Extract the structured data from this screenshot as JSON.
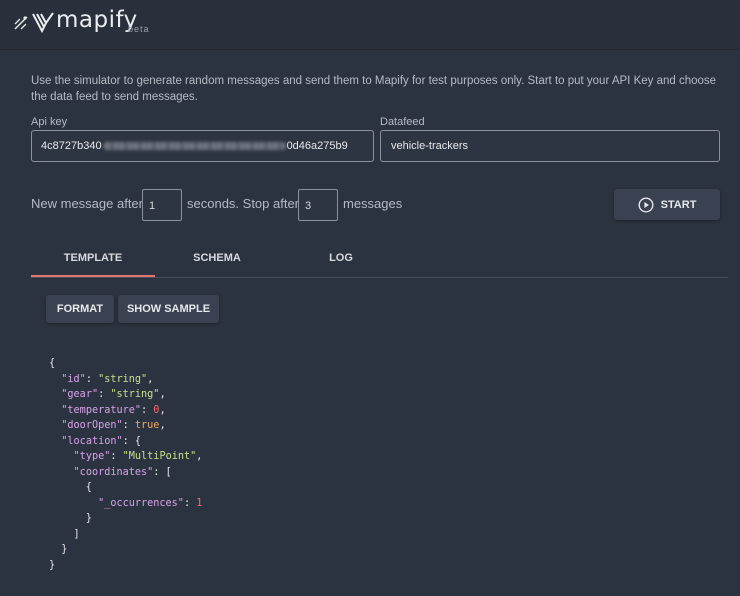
{
  "header": {
    "brand": "mapify",
    "badge": "beta",
    "icons": [
      "tool-icon",
      "mapify-logo-icon"
    ]
  },
  "intro": "Use the simulator to generate random messages and send them to Mapify for test purposes only. Start to put your API Key and choose the data feed to send messages.",
  "form": {
    "api_key_label": "Api key",
    "api_key_prefix": "4c8727b340",
    "api_key_suffix": "0d46a275b9",
    "datafeed_label": "Datafeed",
    "datafeed_value": "vehicle-trackers"
  },
  "schedule": {
    "new_message_text": "New message after",
    "seconds_value": "1",
    "seconds_text": "seconds. Stop after",
    "stop_value": "3",
    "messages_text": "messages"
  },
  "start_button": {
    "label": "START",
    "icon": "play-circle-icon"
  },
  "tabs": [
    {
      "label": "TEMPLATE",
      "active": true
    },
    {
      "label": "SCHEMA",
      "active": false
    },
    {
      "label": "LOG",
      "active": false
    }
  ],
  "actions": {
    "format_label": "FORMAT",
    "show_sample_label": "SHOW SAMPLE"
  },
  "template": {
    "keys": [
      "\"id\"",
      "\"gear\"",
      "\"temperature\"",
      "\"doorOpen\"",
      "\"location\"",
      "\"type\"",
      "\"coordinates\"",
      "\"_occurrences\""
    ],
    "values": {
      "id": "\"string\"",
      "gear": "\"string\"",
      "temperature": "0",
      "doorOpen": "true",
      "type": "\"MultiPoint\"",
      "occurrences": "1"
    }
  },
  "colors": {
    "background": "#2c3340",
    "header": "#2a303b",
    "tab_indicator": "#e0796b",
    "json_key": "#d7a3e8",
    "json_string": "#c8e08d",
    "json_number": "#f26a6a",
    "json_boolean": "#f0a861"
  }
}
